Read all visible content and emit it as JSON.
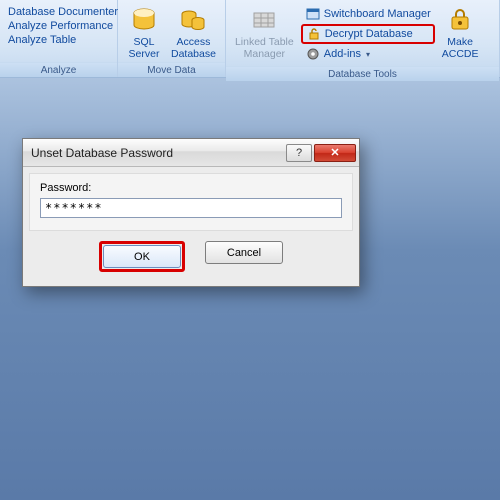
{
  "ribbon": {
    "analyze": {
      "items": [
        "Database Documenter",
        "Analyze Performance",
        "Analyze Table"
      ],
      "label": "Analyze"
    },
    "move_data": {
      "sql_server": "SQL\nServer",
      "access_db": "Access\nDatabase",
      "label": "Move Data"
    },
    "db_tools": {
      "linked_table": "Linked Table\nManager",
      "switchboard": "Switchboard Manager",
      "decrypt": "Decrypt Database",
      "addins": "Add-ins",
      "make_accde": "Make\nACCDE",
      "label": "Database Tools"
    }
  },
  "dialog": {
    "title": "Unset Database Password",
    "password_label": "Password:",
    "password_value": "*******",
    "ok": "OK",
    "cancel": "Cancel"
  }
}
